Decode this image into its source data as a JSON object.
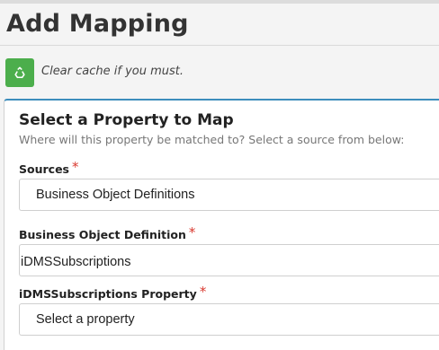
{
  "page": {
    "title": "Add Mapping"
  },
  "cache": {
    "icon": "recycle-icon",
    "message": "Clear cache if you must."
  },
  "card": {
    "title": "Select a Property to Map",
    "subtitle": "Where will this property be matched to? Select a source from below:"
  },
  "fields": [
    {
      "label": "Sources",
      "required": "*",
      "value": "Business Object Definitions"
    },
    {
      "label": "Business Object Definition",
      "required": "*",
      "value": "iDMSSubscriptions"
    },
    {
      "label": "iDMSSubscriptions Property",
      "required": "*",
      "value": "Select a property"
    }
  ],
  "colors": {
    "accent": "#3c8dbc",
    "button": "#4cae4c",
    "required": "#d9392f"
  }
}
